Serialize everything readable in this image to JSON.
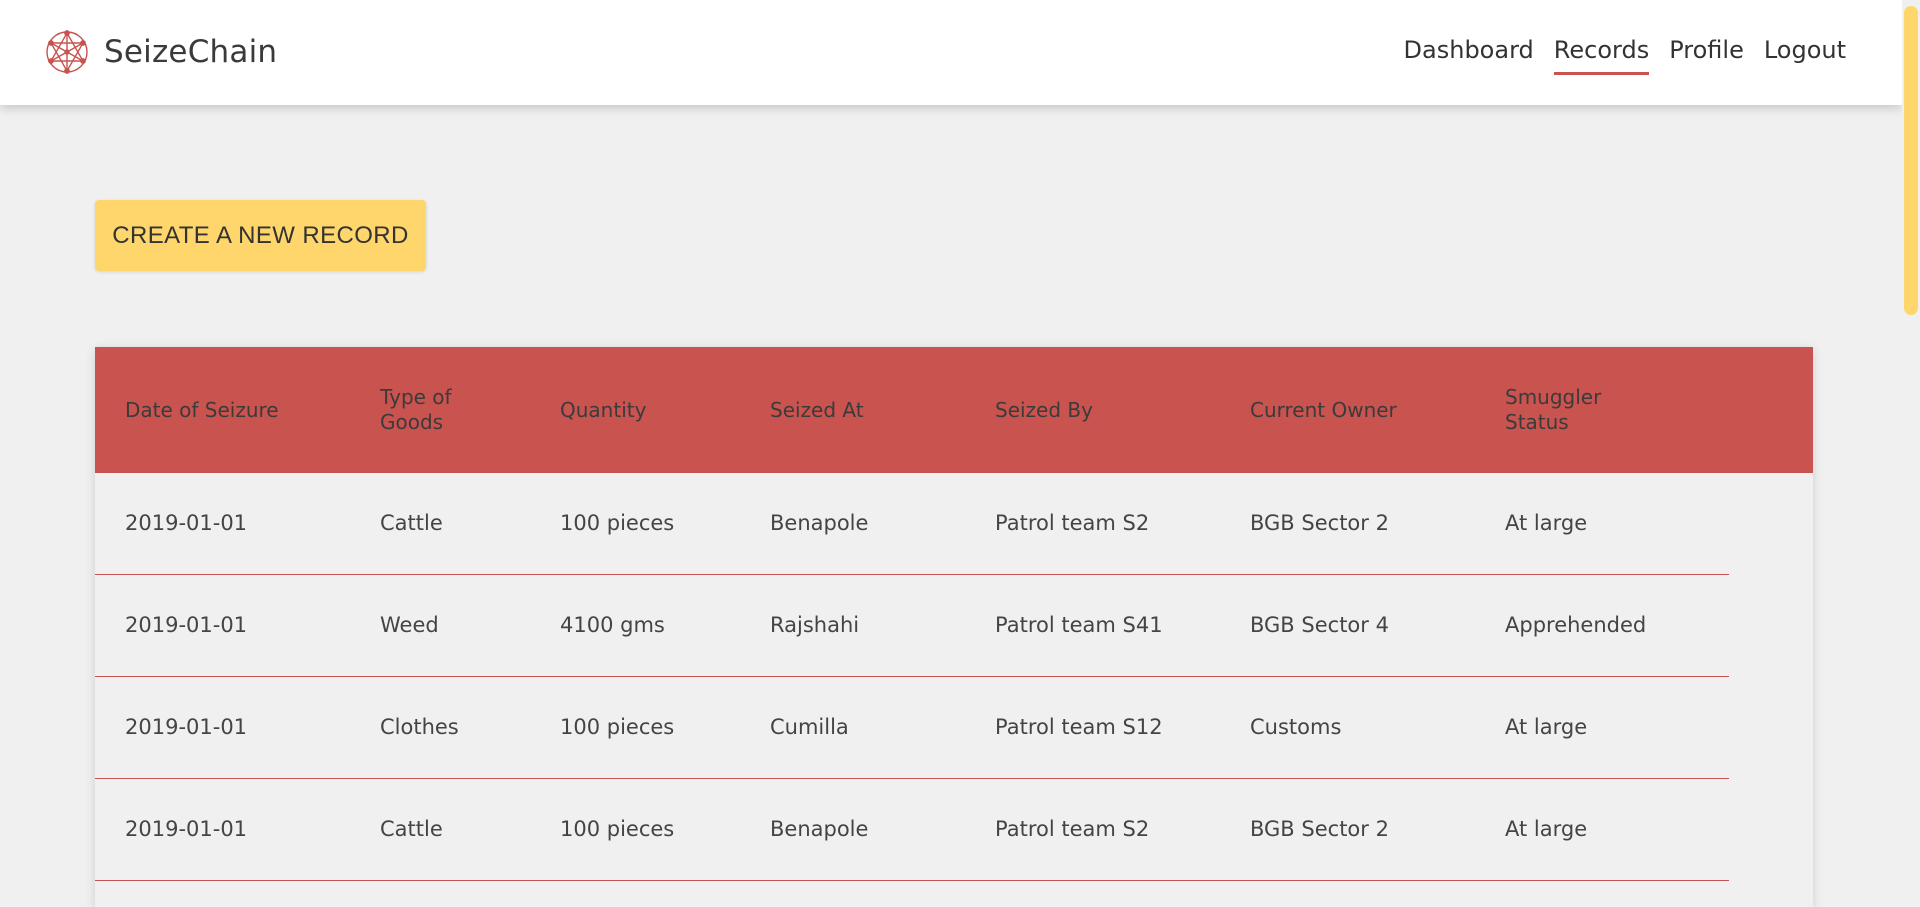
{
  "brand": {
    "name": "SeizeChain",
    "logo_icon": "network-logo-icon",
    "logo_color": "#c8534f"
  },
  "nav": {
    "items": [
      {
        "label": "Dashboard",
        "active": false
      },
      {
        "label": "Records",
        "active": true
      },
      {
        "label": "Profile",
        "active": false
      },
      {
        "label": "Logout",
        "active": false
      }
    ]
  },
  "actions": {
    "create_label": "CREATE A NEW RECORD"
  },
  "table": {
    "headers": [
      "Date of Seizure",
      "Type of Goods",
      "Quantity",
      "Seized At",
      "Seized By",
      "Current Owner",
      "Smuggler Status"
    ],
    "rows": [
      [
        "2019-01-01",
        "Cattle",
        "100 pieces",
        "Benapole",
        "Patrol team S2",
        "BGB Sector 2",
        "At large"
      ],
      [
        "2019-01-01",
        "Weed",
        "4100 gms",
        "Rajshahi",
        "Patrol team S41",
        "BGB Sector 4",
        "Apprehended"
      ],
      [
        "2019-01-01",
        "Clothes",
        "100 pieces",
        "Cumilla",
        "Patrol team S12",
        "Customs",
        "At large"
      ],
      [
        "2019-01-01",
        "Cattle",
        "100 pieces",
        "Benapole",
        "Patrol team S2",
        "BGB Sector 2",
        "At large"
      ]
    ]
  },
  "colors": {
    "accent": "#c8534f",
    "button": "#ffd66b",
    "background": "#f0f0f0"
  }
}
